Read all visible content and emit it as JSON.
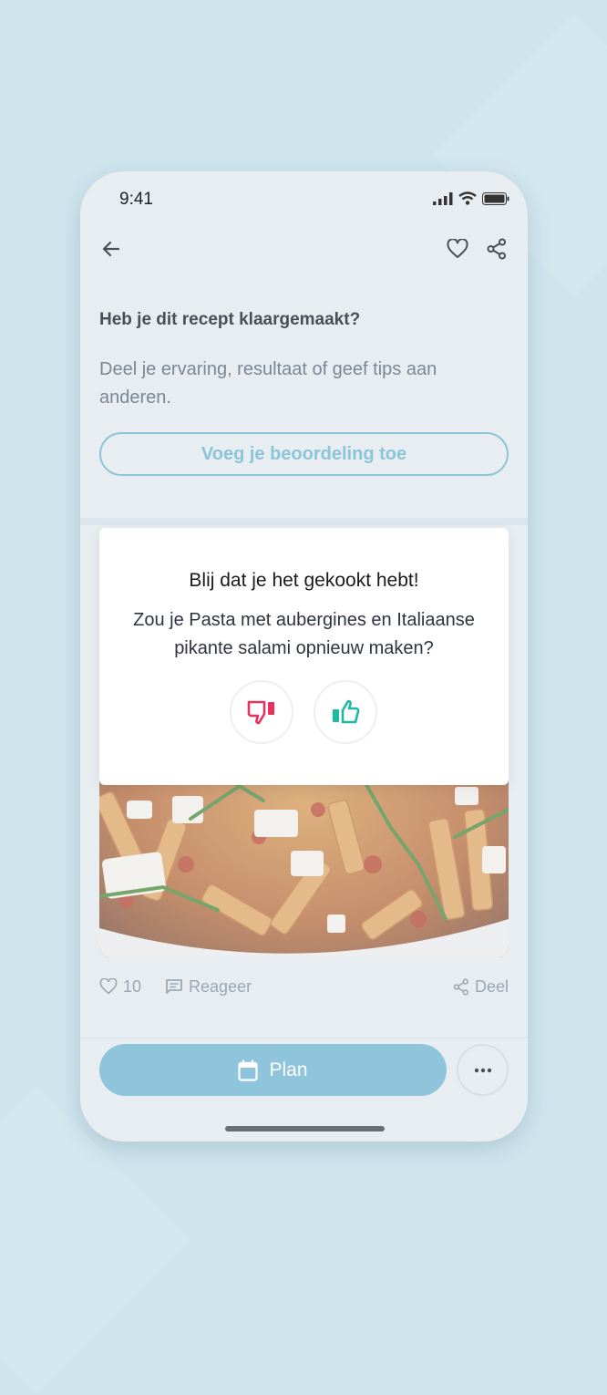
{
  "status_bar": {
    "time": "9:41"
  },
  "header": {
    "back_icon": "arrow-left-icon",
    "favorite_icon": "heart-icon",
    "share_icon": "share-icon"
  },
  "rating_prompt": {
    "title": "Heb je dit recept klaargemaakt?",
    "description": "Deel je ervaring, resultaat of geef tips aan anderen.",
    "button_label": "Voeg je beoordeling toe"
  },
  "feedback_modal": {
    "title": "Blij dat je het gekookt hebt!",
    "question": "Zou je Pasta met aubergines en Italiaanse pikante salami opnieuw maken?",
    "thumbs_down_icon": "thumbs-down-icon",
    "thumbs_up_icon": "thumbs-up-icon"
  },
  "actions": {
    "likes_count": "10",
    "comment_label": "Reageer",
    "share_label": "Deel"
  },
  "bottom_bar": {
    "plan_label": "Plan",
    "plan_icon": "calendar-icon",
    "more_icon": "more-dots-icon"
  },
  "colors": {
    "accent": "#8ec5da",
    "thumbs_down": "#e8325c",
    "thumbs_up": "#1fb8a5",
    "background": "#cfe5ee"
  }
}
